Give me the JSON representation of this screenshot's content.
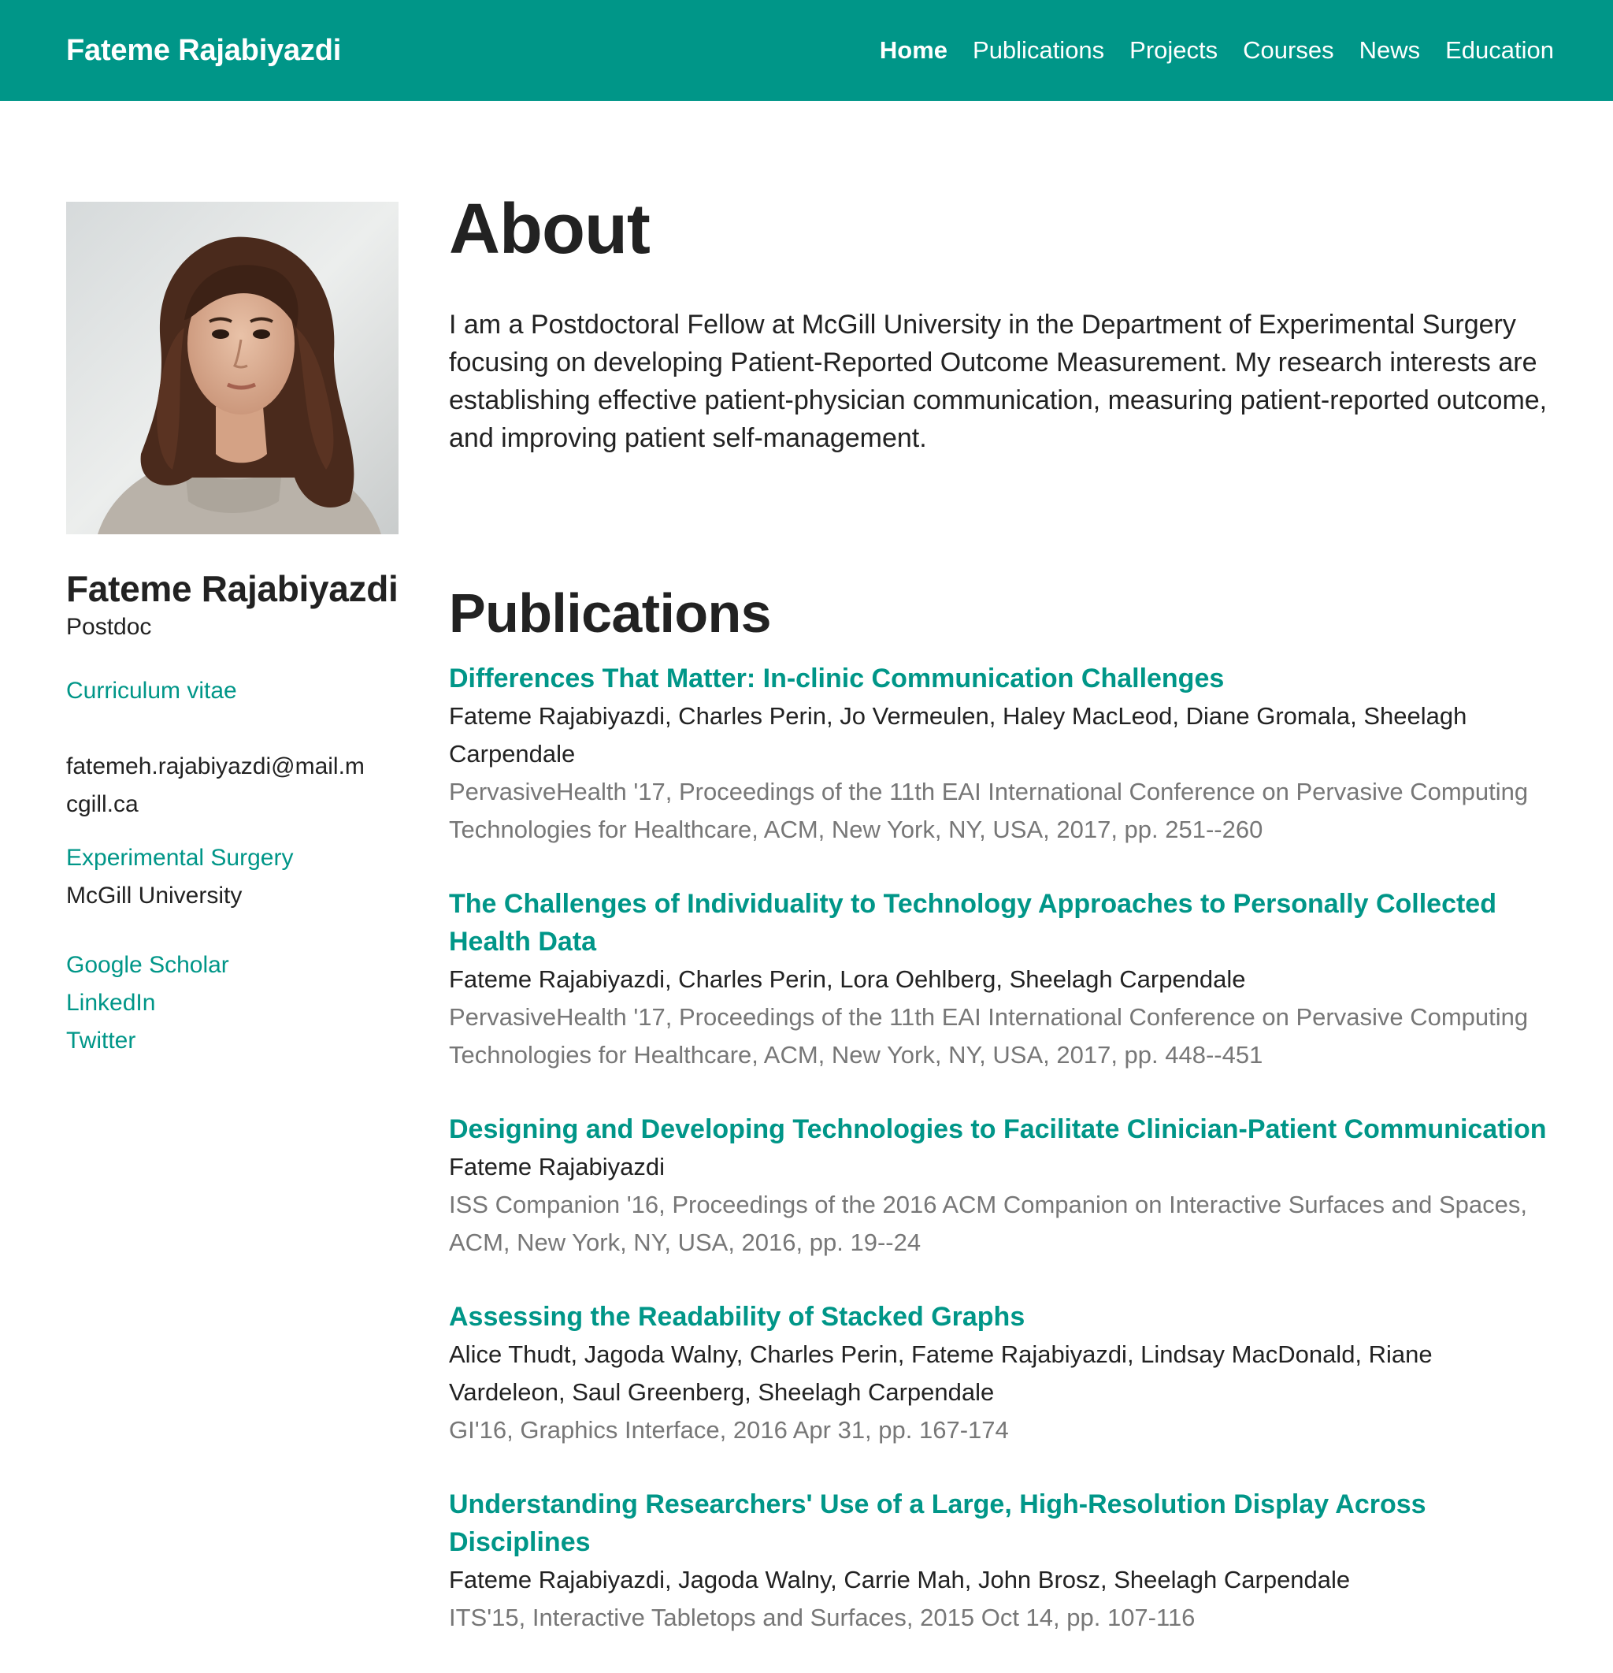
{
  "nav": {
    "brand": "Fateme Rajabiyazdi",
    "links": [
      "Home",
      "Publications",
      "Projects",
      "Courses",
      "News",
      "Education"
    ]
  },
  "colors": {
    "accent": "#009688",
    "text": "#222222",
    "muted": "#777777"
  },
  "sidebar": {
    "name": "Fateme Rajabiyazdi",
    "role": "Postdoc",
    "cv_link": "Curriculum vitae",
    "email": "fatemeh.rajabiyazdi@mail.mcgill.ca",
    "department": "Experimental Surgery",
    "university": "McGill University",
    "social": [
      "Google Scholar",
      "LinkedIn",
      "Twitter"
    ]
  },
  "about": {
    "heading": "About",
    "text": "I am a Postdoctoral Fellow at McGill University in the Department of Experimental Surgery focusing on developing Patient-Reported Outcome Measurement. My research interests are establishing effective patient-physician communication, measuring patient-reported outcome, and improving patient self-management."
  },
  "publications": {
    "heading": "Publications",
    "items": [
      {
        "title": "Differences That Matter: In-clinic Communication Challenges",
        "authors": "Fateme Rajabiyazdi, Charles Perin, Jo Vermeulen, Haley MacLeod, Diane Gromala, Sheelagh Carpendale",
        "venue": "PervasiveHealth '17, Proceedings of the 11th EAI International Conference on Pervasive Computing Technologies for Healthcare, ACM, New York, NY, USA, 2017, pp. 251--260"
      },
      {
        "title": "The Challenges of Individuality to Technology Approaches to Personally Collected Health Data",
        "authors": "Fateme Rajabiyazdi, Charles Perin, Lora Oehlberg, Sheelagh Carpendale",
        "venue": "PervasiveHealth '17, Proceedings of the 11th EAI International Conference on Pervasive Computing Technologies for Healthcare, ACM, New York, NY, USA, 2017, pp. 448--451"
      },
      {
        "title": "Designing and Developing Technologies to Facilitate Clinician-Patient Communication",
        "authors": "Fateme Rajabiyazdi",
        "venue": "ISS Companion '16, Proceedings of the 2016 ACM Companion on Interactive Surfaces and Spaces, ACM, New York, NY, USA, 2016, pp. 19--24"
      },
      {
        "title": "Assessing the Readability of Stacked Graphs",
        "authors": "Alice Thudt, Jagoda Walny, Charles Perin, Fateme Rajabiyazdi, Lindsay MacDonald, Riane Vardeleon, Saul Greenberg, Sheelagh Carpendale",
        "venue": "GI'16, Graphics Interface, 2016 Apr 31, pp. 167-174"
      },
      {
        "title": "Understanding Researchers' Use of a Large, High-Resolution Display Across Disciplines",
        "authors": "Fateme Rajabiyazdi, Jagoda Walny, Carrie Mah, John Brosz, Sheelagh Carpendale",
        "venue": "ITS'15, Interactive Tabletops and Surfaces, 2015 Oct 14, pp. 107-116"
      }
    ]
  }
}
